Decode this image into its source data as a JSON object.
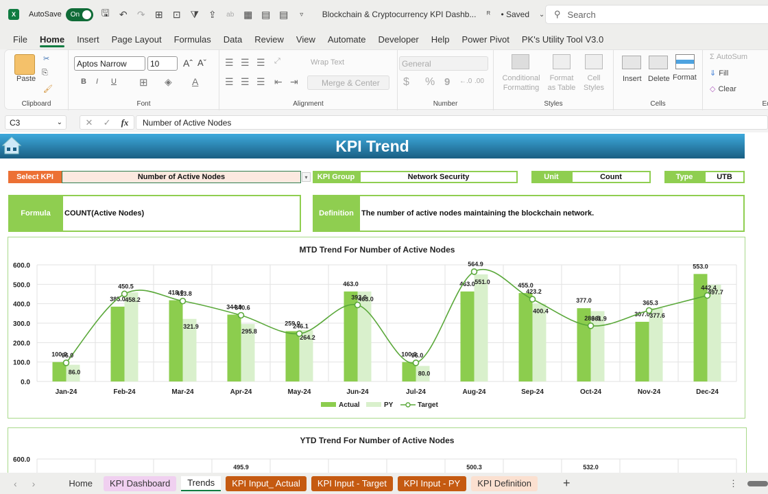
{
  "titlebar": {
    "autosave_label": "AutoSave",
    "autosave_state": "On",
    "doc_title": "Blockchain & Cryptocurrency KPI Dashb...",
    "saved_status": "• Saved",
    "search_placeholder": "Search"
  },
  "menu": [
    "File",
    "Home",
    "Insert",
    "Page Layout",
    "Formulas",
    "Data",
    "Review",
    "View",
    "Automate",
    "Developer",
    "Help",
    "Power Pivot",
    "PK's Utility Tool V3.0"
  ],
  "menu_active": "Home",
  "ribbon": {
    "clipboard": {
      "paste": "Paste",
      "label": "Clipboard"
    },
    "font": {
      "name": "Aptos Narrow",
      "size": "10",
      "label": "Font",
      "bold": "B",
      "italic": "I",
      "underline": "U"
    },
    "alignment": {
      "wrap": "Wrap Text",
      "merge": "Merge & Center",
      "label": "Alignment"
    },
    "number": {
      "format": "General",
      "label": "Number",
      "currency": "$",
      "percent": "%",
      "comma": "9"
    },
    "styles": {
      "conditional": "Conditional Formatting",
      "format_table": "Format as Table",
      "cell_styles": "Cell Styles",
      "label": "Styles"
    },
    "cells": {
      "insert": "Insert",
      "delete": "Delete",
      "format": "Format",
      "label": "Cells"
    },
    "editing": {
      "autosum": "AutoSum",
      "fill": "Fill",
      "clear": "Clear",
      "label": "Editi"
    }
  },
  "formula_bar": {
    "cell_ref": "C3",
    "content": "Number of Active Nodes"
  },
  "dashboard": {
    "title": "KPI Trend",
    "select_kpi_label": "Select KPI",
    "select_kpi_value": "Number of Active Nodes",
    "kpi_group_label": "KPI Group",
    "kpi_group_value": "Network Security",
    "unit_label": "Unit",
    "unit_value": "Count",
    "type_label": "Type",
    "type_value": "UTB",
    "formula_label": "Formula",
    "formula_value": "COUNT(Active Nodes)",
    "definition_label": "Definition",
    "definition_value": "The number of active nodes maintaining the blockchain network."
  },
  "colors": {
    "actual": "#8ccd4e",
    "py": "#d9f0cc",
    "target": "#5aa83a",
    "orange": "#ec7034",
    "label_green": "#8fce50"
  },
  "chart_data": [
    {
      "type": "bar",
      "title": "MTD Trend For Number of Active Nodes",
      "categories": [
        "Jan-24",
        "Feb-24",
        "Mar-24",
        "Apr-24",
        "May-24",
        "Jun-24",
        "Jul-24",
        "Aug-24",
        "Sep-24",
        "Oct-24",
        "Nov-24",
        "Dec-24"
      ],
      "series": [
        {
          "name": "Actual",
          "type": "bar",
          "values": [
            100.0,
            385.0,
            418.0,
            344.0,
            259.0,
            463.0,
            100.0,
            463.0,
            455.0,
            377.0,
            307.0,
            553.0
          ]
        },
        {
          "name": "PY",
          "type": "bar",
          "values": [
            86.0,
            458.2,
            321.9,
            295.8,
            264.2,
            463.0,
            80.0,
            551.0,
            400.4,
            361.9,
            377.6,
            497.7
          ]
        },
        {
          "name": "Target",
          "type": "line",
          "values": [
            96.0,
            450.5,
            413.8,
            340.6,
            246.1,
            393.6,
            96.0,
            564.9,
            423.2,
            286.5,
            365.3,
            442.4
          ]
        }
      ],
      "yticks": [
        "0.0",
        "100.0",
        "200.0",
        "300.0",
        "400.0",
        "500.0",
        "600.0"
      ],
      "ylim": [
        0,
        600
      ],
      "legend": "bottom",
      "grid": true
    },
    {
      "type": "bar",
      "title": "YTD Trend For Number of Active Nodes",
      "yticks": [
        "600.0"
      ],
      "visible_labels": [
        "495.9",
        "500.3",
        "532.0"
      ]
    }
  ],
  "sheet_tabs": [
    {
      "label": "Home",
      "style": "plain"
    },
    {
      "label": "KPI Dashboard",
      "style": "pink"
    },
    {
      "label": "Trends",
      "style": "active"
    },
    {
      "label": "KPI Input_ Actual",
      "style": "orange"
    },
    {
      "label": "KPI Input - Target",
      "style": "orange"
    },
    {
      "label": "KPI Input - PY",
      "style": "orange"
    },
    {
      "label": "KPI Definition",
      "style": "peach"
    }
  ],
  "add_sheet": "+"
}
